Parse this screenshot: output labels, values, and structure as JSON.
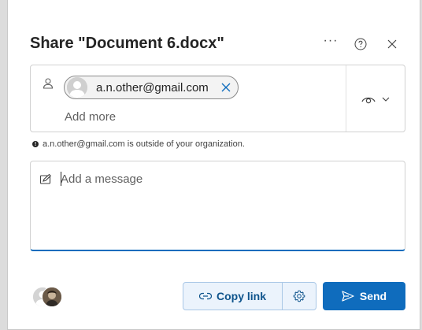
{
  "dialog": {
    "title": "Share \"Document 6.docx\"",
    "header_buttons": {
      "more": "···",
      "help_icon": "question-circle-icon",
      "close_icon": "close-icon"
    }
  },
  "recipients": {
    "person_icon": "person-icon",
    "chips": [
      {
        "email": "a.n.other@gmail.com",
        "avatar_icon": "avatar-placeholder",
        "remove_icon": "dismiss-icon"
      }
    ],
    "add_more_placeholder": "Add more",
    "permission": {
      "icon": "eye-icon",
      "dropdown_icon": "chevron-down-icon"
    }
  },
  "notice": {
    "icon": "info-icon",
    "text": "a.n.other@gmail.com is outside of your organization."
  },
  "message": {
    "icon": "edit-icon",
    "placeholder": "Add a message",
    "value": ""
  },
  "footer": {
    "copy_link_label": "Copy link",
    "copy_link_icon": "link-icon",
    "settings_icon": "gear-icon",
    "send_label": "Send",
    "send_icon": "send-icon"
  },
  "colors": {
    "accent": "#0f6cbd",
    "copy_bg": "#ebf3fc",
    "copy_text": "#0f548c"
  }
}
